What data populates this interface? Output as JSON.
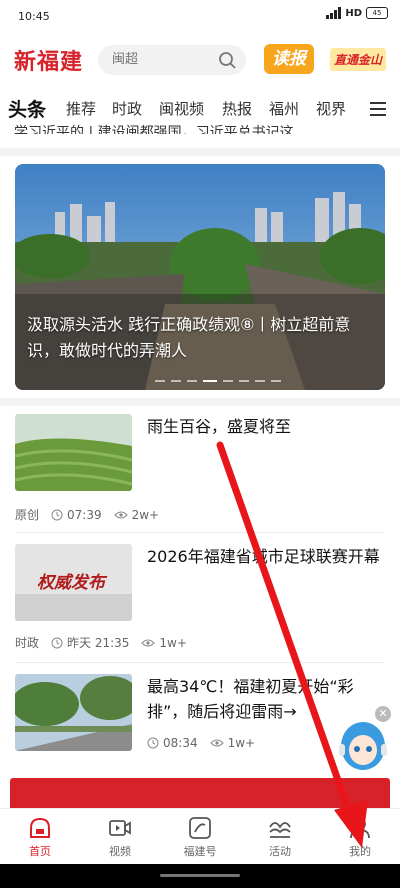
{
  "status_bar": {
    "time": "10:45",
    "network": "HD",
    "battery": "45"
  },
  "header": {
    "logo": "新福建",
    "search_placeholder": "闽超",
    "read_button": "读报",
    "mountain_button": "直通金山"
  },
  "tabs": [
    "头条",
    "推荐",
    "时政",
    "闽视频",
    "热报",
    "福州",
    "视界"
  ],
  "hidden_line": "学习近平的 | 建设闽都强国，习近平总书记这",
  "hero": {
    "title": "汲取源头活水 践行正确政绩观⑧丨树立超前意识，敢做时代的弄潮人",
    "dots": 8,
    "active_dot": 4
  },
  "articles": [
    {
      "title": "雨生百谷，盛夏将至",
      "source": "原创",
      "time": "07:39",
      "views": "2w+"
    },
    {
      "title": "2026年福建省城市足球联赛开幕",
      "thumb_text": "权威发布",
      "source": "时政",
      "time": "昨天 21:35",
      "views": "1w+"
    },
    {
      "title": "最高34℃！福建初夏开始“彩排”，随后将迎雷雨→",
      "source": "",
      "time": "08:34",
      "views": "1w+"
    }
  ],
  "bottom_nav": [
    {
      "label": "首页",
      "icon": "home-icon",
      "active": true
    },
    {
      "label": "视频",
      "icon": "video-icon",
      "active": false
    },
    {
      "label": "福建号",
      "icon": "fujian-account-icon",
      "active": false
    },
    {
      "label": "活动",
      "icon": "activity-icon",
      "active": false
    },
    {
      "label": "我的",
      "icon": "profile-icon",
      "active": false
    }
  ],
  "colors": {
    "brand_red": "#d8222a",
    "read_orange": "#f7a51c",
    "arrow_red": "#e8161b"
  }
}
